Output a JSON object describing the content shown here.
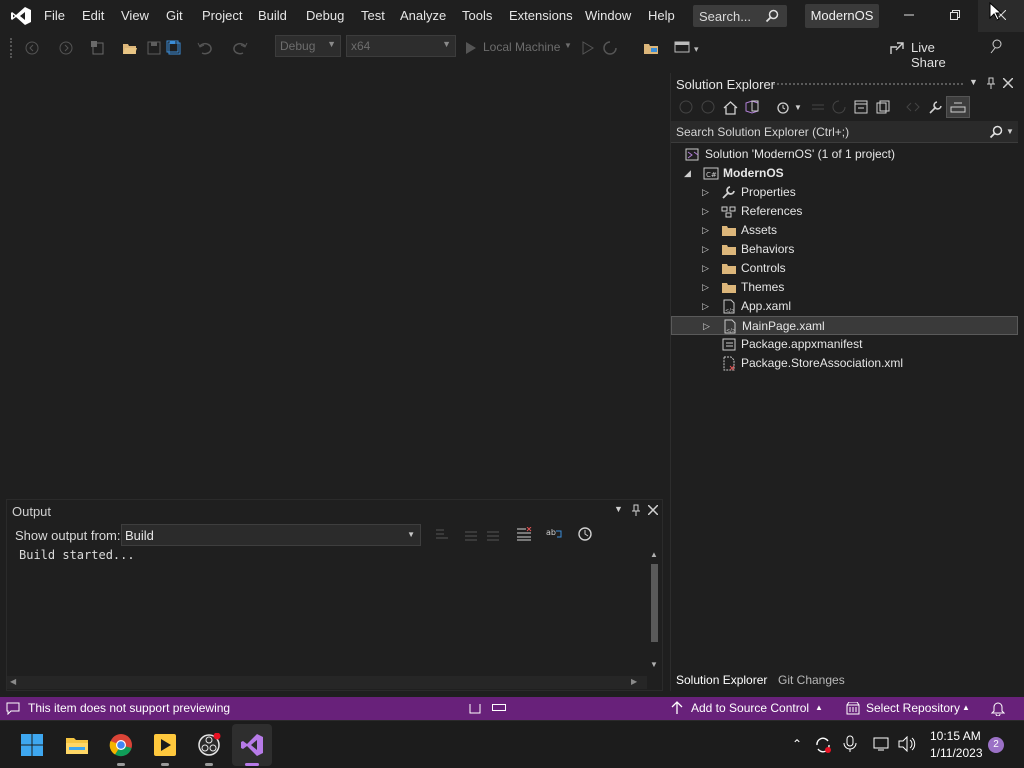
{
  "titlebar": {
    "menu": [
      "File",
      "Edit",
      "View",
      "Git",
      "Project",
      "Build",
      "Debug",
      "Test",
      "Analyze",
      "Tools",
      "Extensions",
      "Window",
      "Help"
    ],
    "search_label": "Search...",
    "solution_name": "ModernOS"
  },
  "toolbar": {
    "configuration": "Debug",
    "platform": "x64",
    "run_target": "Local Machine",
    "live_share": "Live Share"
  },
  "solution_explorer": {
    "title": "Solution Explorer",
    "search_placeholder": "Search Solution Explorer (Ctrl+;)",
    "tree": [
      {
        "label": "Solution 'ModernOS' (1 of 1 project)",
        "icon": "solution-icon",
        "level": 0,
        "expander": ""
      },
      {
        "label": "ModernOS",
        "icon": "csharp-project-icon",
        "level": 1,
        "expander": "expanded"
      },
      {
        "label": "Properties",
        "icon": "wrench-icon",
        "level": 2,
        "expander": "collapsed"
      },
      {
        "label": "References",
        "icon": "references-icon",
        "level": 2,
        "expander": "collapsed"
      },
      {
        "label": "Assets",
        "icon": "folder-icon",
        "level": 2,
        "expander": "collapsed"
      },
      {
        "label": "Behaviors",
        "icon": "folder-icon",
        "level": 2,
        "expander": "collapsed"
      },
      {
        "label": "Controls",
        "icon": "folder-icon",
        "level": 2,
        "expander": "collapsed"
      },
      {
        "label": "Themes",
        "icon": "folder-icon",
        "level": 2,
        "expander": "collapsed"
      },
      {
        "label": "App.xaml",
        "icon": "xaml-file-icon",
        "level": 2,
        "expander": "collapsed"
      },
      {
        "label": "MainPage.xaml",
        "icon": "xaml-file-icon",
        "level": 2,
        "expander": "collapsed",
        "selected": true
      },
      {
        "label": "Package.appxmanifest",
        "icon": "manifest-icon",
        "level": 2,
        "expander": ""
      },
      {
        "label": "Package.StoreAssociation.xml",
        "icon": "xml-file-icon",
        "level": 2,
        "expander": ""
      }
    ],
    "tabs": [
      "Solution Explorer",
      "Git Changes"
    ]
  },
  "output": {
    "title": "Output",
    "show_from_label": "Show output from:",
    "source": "Build",
    "text": "Build started..."
  },
  "statusbar": {
    "message": "This item does not support previewing",
    "source_control": "Add to Source Control",
    "repository": "Select Repository",
    "color": "#68217a"
  },
  "taskbar": {
    "time": "10:15 AM",
    "date": "1/11/2023",
    "notification_count": "2"
  }
}
